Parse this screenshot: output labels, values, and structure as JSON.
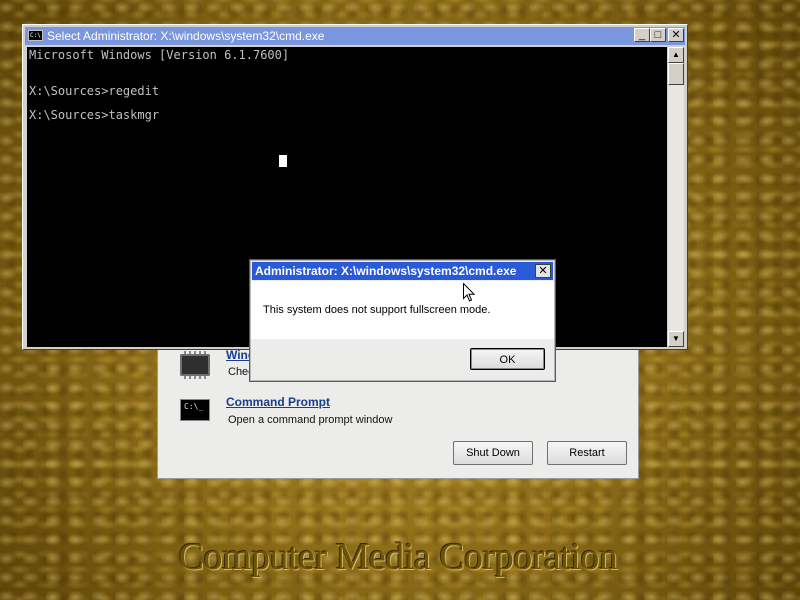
{
  "watermark": "Computer Media Corporation",
  "recovery": {
    "tools": [
      {
        "icon": "memory-chip-icon",
        "title": "Wind",
        "desc": "Chec"
      },
      {
        "icon": "command-prompt-icon",
        "icon_text": "C:\\_",
        "title": "Command Prompt",
        "desc": "Open a command prompt window"
      }
    ],
    "shutdown_label": "Shut Down",
    "restart_label": "Restart"
  },
  "cmd_window": {
    "title": "Select Administrator: X:\\windows\\system32\\cmd.exe",
    "icon_text": "C:\\",
    "lines": [
      "Microsoft Windows [Version 6.1.7600]",
      "X:\\Sources>regedit",
      "X:\\Sources>taskmgr"
    ],
    "minimize": "_",
    "maximize": "□",
    "close": "✕",
    "scroll_up": "▲",
    "scroll_down": "▼"
  },
  "message_box": {
    "title": "Administrator: X:\\windows\\system32\\cmd.exe",
    "close": "✕",
    "message": "This system does not support fullscreen mode.",
    "ok_label": "OK"
  },
  "colors": {
    "cmd_title_bg": "#7a96df",
    "msg_title_bg": "#2a5ad7",
    "link": "#1a3c8f"
  }
}
